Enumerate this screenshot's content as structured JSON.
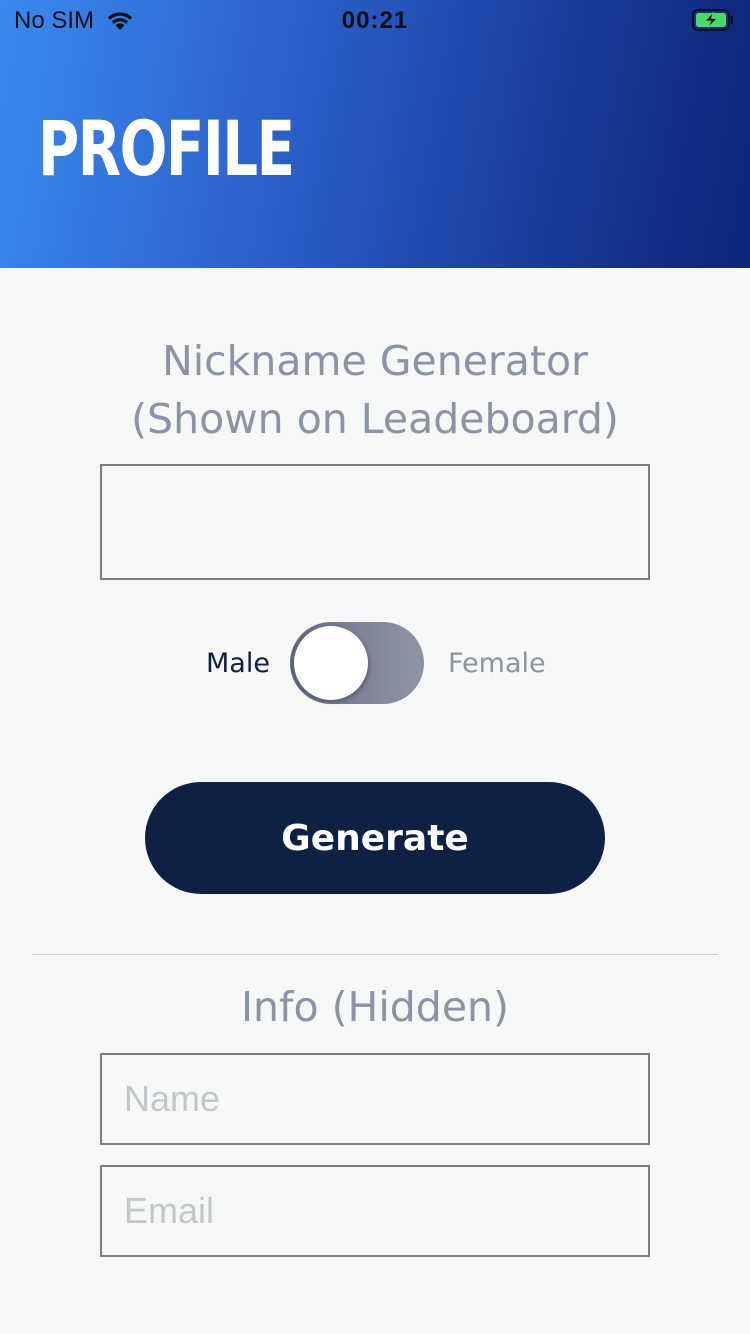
{
  "status_bar": {
    "carrier": "No SIM",
    "time": "00:21"
  },
  "header": {
    "title": "PROFILE"
  },
  "nickname": {
    "title_line1": "Nickname Generator",
    "title_line2": "(Shown on Leadeboard)",
    "value": ""
  },
  "gender": {
    "left_label": "Male",
    "right_label": "Female",
    "selected": "Male"
  },
  "generate_label": "Generate",
  "info": {
    "title": "Info (Hidden)",
    "name_placeholder": "Name",
    "email_placeholder": "Email"
  },
  "colors": {
    "primary_navy": "#0e2144",
    "header_gradient_start": "#3a8aef",
    "header_gradient_end": "#0b2577",
    "muted_text": "#8a94a6"
  },
  "icons": {
    "wifi": "wifi-icon",
    "battery": "battery-charging-icon"
  }
}
